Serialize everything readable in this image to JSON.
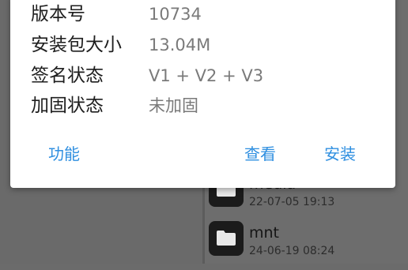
{
  "dialog": {
    "rows": [
      {
        "label": "版本号",
        "value": "10734"
      },
      {
        "label": "安装包大小",
        "value": "13.04M"
      },
      {
        "label": "签名状态",
        "value": "V1 + V2 + V3"
      },
      {
        "label": "加固状态",
        "value": "未加固"
      }
    ],
    "buttons": {
      "function_label": "功能",
      "view_label": "查看",
      "install_label": "安装"
    },
    "accent_color": "#2f8fe0"
  },
  "file_list": {
    "items": [
      {
        "name": "media",
        "date": "22-07-05 19:13",
        "icon": "folder-icon"
      },
      {
        "name": "mnt",
        "date": "24-06-19 08:24",
        "icon": "folder-icon"
      }
    ]
  }
}
